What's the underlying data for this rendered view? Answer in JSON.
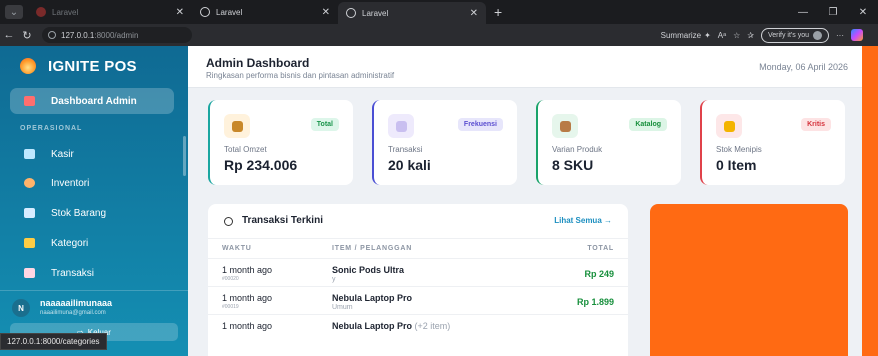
{
  "browser": {
    "tabs": [
      {
        "title": "Laravel",
        "favicon": "ignite-favicon",
        "muted": true
      },
      {
        "title": "Laravel",
        "favicon": "globe-icon",
        "muted": false
      },
      {
        "title": "Laravel",
        "favicon": "globe-icon",
        "muted": false,
        "active": true
      }
    ],
    "address": {
      "host": "127.0.0.1",
      "path": ":8000/admin"
    },
    "summarize_label": "Summarize",
    "verify_label": "Verify it's you",
    "status_url": "127.0.0.1:8000/categories"
  },
  "sidebar": {
    "brand": "IGNITE POS",
    "section_operational": "OPERASIONAL",
    "items": [
      {
        "label": "Dashboard Admin",
        "icon": "dashboard-icon",
        "active": true
      },
      {
        "label": "Kasir",
        "icon": "cashier-icon"
      },
      {
        "label": "Inventori",
        "icon": "inventory-icon"
      },
      {
        "label": "Stok Barang",
        "icon": "stock-icon"
      },
      {
        "label": "Kategori",
        "icon": "folder-icon"
      },
      {
        "label": "Transaksi",
        "icon": "transaction-icon"
      }
    ],
    "user": {
      "initial": "N",
      "name": "naaaaailimunaaa",
      "email": "naaailimuna@gmail.com"
    },
    "logout_label": "Keluar"
  },
  "header": {
    "title": "Admin Dashboard",
    "subtitle": "Ringkasan performa bisnis dan pintasan administratif",
    "date": "Monday, 06 April 2026"
  },
  "stats": [
    {
      "badge": "Total",
      "label": "Total Omzet",
      "value": "Rp 234.006",
      "accent": "#1aa6a0",
      "badge_bg": "#ddf6ea",
      "badge_color": "#18944a",
      "icon": "money-bag-icon",
      "icon_bg": "#fff2dc",
      "icon_color": "#c8882a"
    },
    {
      "badge": "Frekuensi",
      "label": "Transaksi",
      "value": "20 kali",
      "accent": "#4b4fd4",
      "badge_bg": "#e7e6fb",
      "badge_color": "#5b4fd0",
      "icon": "receipt-icon",
      "icon_bg": "#eeeafc",
      "icon_color": "#c9bff0"
    },
    {
      "badge": "Katalog",
      "label": "Varian Produk",
      "value": "8 SKU",
      "accent": "#1aa36a",
      "badge_bg": "#dcf5e6",
      "badge_color": "#178f3c",
      "icon": "package-icon",
      "icon_bg": "#e6f6ec",
      "icon_color": "#b87b46"
    },
    {
      "badge": "Kritis",
      "label": "Stok Menipis",
      "value": "0 Item",
      "accent": "#e0414a",
      "badge_bg": "#fde3e4",
      "badge_color": "#d5323c",
      "icon": "warning-icon",
      "icon_bg": "#fde7e8",
      "icon_color": "#f4b400"
    }
  ],
  "transactions": {
    "title": "Transaksi Terkini",
    "link": "Lihat Semua →",
    "columns": [
      "WAKTU",
      "ITEM / PELANGGAN",
      "TOTAL"
    ],
    "rows": [
      {
        "time": "1 month ago",
        "id": "#00020",
        "item": "Sonic Pods Ultra",
        "extra": "",
        "customer": "y",
        "total": "Rp 249"
      },
      {
        "time": "1 month ago",
        "id": "#00019",
        "item": "Nebula Laptop Pro",
        "extra": "",
        "customer": "Umum",
        "total": "Rp 1.899"
      },
      {
        "time": "1 month ago",
        "id": "",
        "item": "Nebula Laptop Pro",
        "extra": "(+2 item)",
        "customer": "",
        "total": ""
      }
    ]
  }
}
